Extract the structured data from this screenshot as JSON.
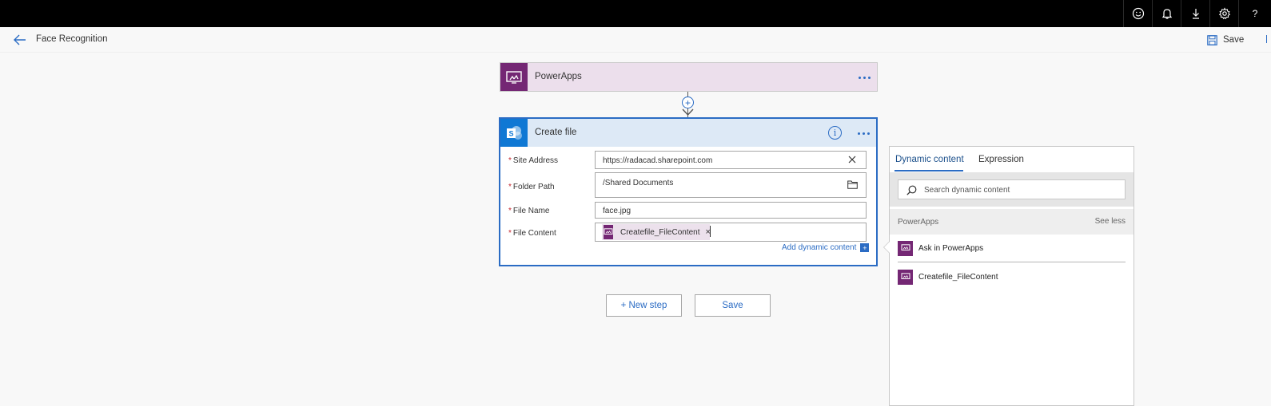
{
  "topbar": {
    "icons": [
      "smiley-icon",
      "bell-icon",
      "download-icon",
      "gear-icon"
    ],
    "help_label": "?"
  },
  "header": {
    "title": "Face Recognition",
    "save_label": "Save"
  },
  "trigger": {
    "label": "PowerApps",
    "icon": "powerapps-icon",
    "color": "#742774",
    "bg": "#ecdfec"
  },
  "action": {
    "title": "Create file",
    "icon": "sharepoint-icon",
    "color": "#0f78d4",
    "fields": {
      "site_address": {
        "label": "Site Address",
        "value": "https://radacad.sharepoint.com"
      },
      "folder_path": {
        "label": "Folder Path",
        "value": "/Shared Documents"
      },
      "file_name": {
        "label": "File Name",
        "value": "face.jpg"
      },
      "file_content": {
        "label": "File Content",
        "token": "Createfile_FileContent"
      }
    },
    "add_dynamic_label": "Add dynamic content",
    "add_dynamic_symbol": "+"
  },
  "buttons": {
    "new_step": "+ New step",
    "save": "Save"
  },
  "dynamic_panel": {
    "tabs": [
      "Dynamic content",
      "Expression"
    ],
    "active_tab": "Dynamic content",
    "search_placeholder": "Search dynamic content",
    "section": "PowerApps",
    "see_less": "See less",
    "items": [
      "Ask in PowerApps",
      "Createfile_FileContent"
    ]
  },
  "colors": {
    "accent": "#2b6cc4",
    "required": "#c4262e"
  }
}
